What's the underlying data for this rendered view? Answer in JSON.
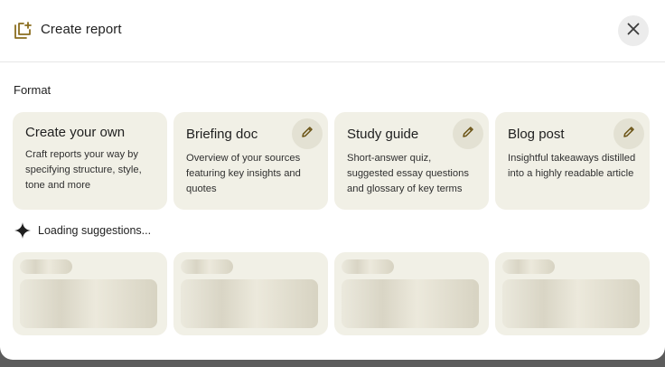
{
  "header": {
    "title": "Create report",
    "icon": "create-report-icon",
    "close_icon": "close-icon"
  },
  "format": {
    "label": "Format",
    "cards": [
      {
        "title": "Create your own",
        "description": "Craft reports your way by specifying structure, style, tone and more",
        "editable": false
      },
      {
        "title": "Briefing doc",
        "description": "Overview of your sources featuring key insights and quotes",
        "editable": true
      },
      {
        "title": "Study guide",
        "description": "Short-answer quiz, suggested essay questions and glossary of key terms",
        "editable": true
      },
      {
        "title": "Blog post",
        "description": "Insightful takeaways distilled into a highly readable article",
        "editable": true
      }
    ]
  },
  "suggestions": {
    "loading_text": "Loading suggestions...",
    "icon": "sparkle-icon",
    "placeholder_count": 4
  },
  "colors": {
    "card_bg": "#f1f0e6",
    "icon_accent": "#8a6d1f",
    "edit_button_bg": "#e3e1d3"
  }
}
